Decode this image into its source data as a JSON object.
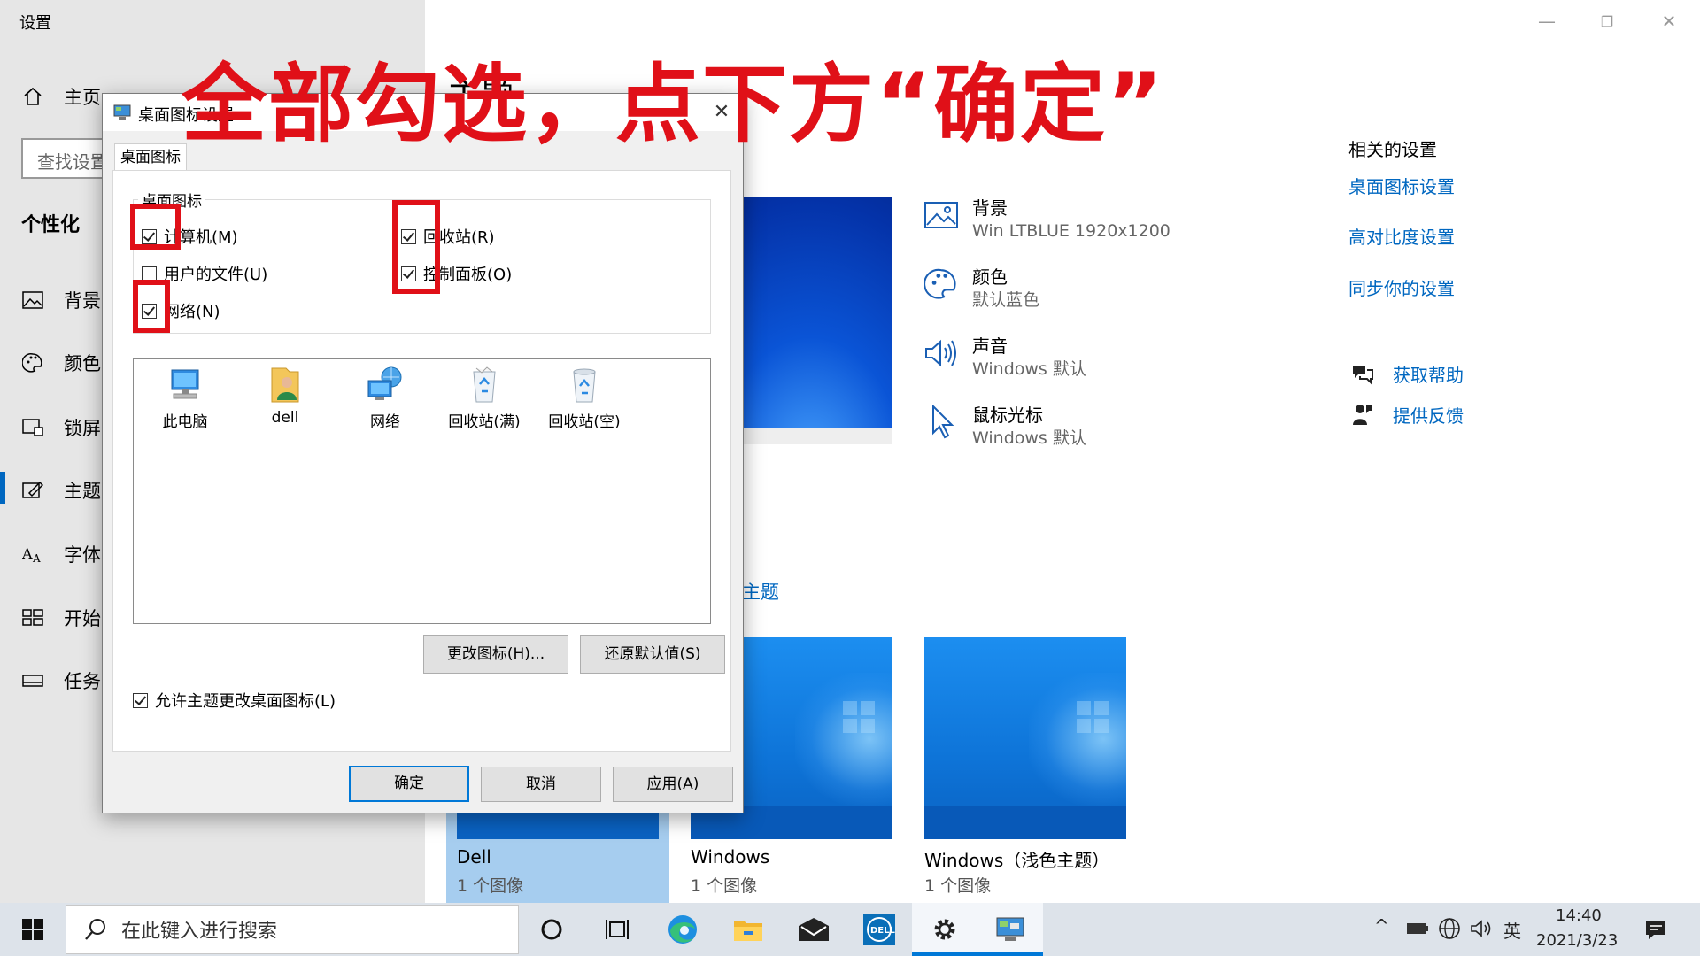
{
  "app": {
    "title": "设置",
    "minimize_glyph": "—",
    "maximize_glyph": "❐",
    "close_glyph": "✕"
  },
  "sidebar": {
    "home_label": "主页",
    "search_placeholder": "查找设置",
    "section_title": "个性化",
    "items": [
      {
        "label": "背景",
        "icon": "picture-icon"
      },
      {
        "label": "颜色",
        "icon": "palette-icon"
      },
      {
        "label": "锁屏",
        "icon": "lockscreen-icon"
      },
      {
        "label": "主题",
        "icon": "theme-icon",
        "active": true
      },
      {
        "label": "字体",
        "icon": "font-icon"
      },
      {
        "label": "开始",
        "icon": "start-icon"
      },
      {
        "label": "任务",
        "icon": "taskbar-icon"
      }
    ]
  },
  "main": {
    "page_title": "主题",
    "properties": [
      {
        "title": "背景",
        "value": "Win LTBLUE 1920x1200",
        "icon": "picture-icon"
      },
      {
        "title": "颜色",
        "value": "默认蓝色",
        "icon": "palette-icon"
      },
      {
        "title": "声音",
        "value": "Windows 默认",
        "icon": "speaker-icon"
      },
      {
        "title": "鼠标光标",
        "value": "Windows 默认",
        "icon": "cursor-icon"
      }
    ],
    "more_themes_link": "主题",
    "themes": [
      {
        "name": "Dell",
        "count": "1 个图像",
        "selected": true
      },
      {
        "name": "Windows",
        "count": "1 个图像"
      },
      {
        "name": "Windows（浅色主题）",
        "count": "1 个图像"
      }
    ]
  },
  "related": {
    "title": "相关的设置",
    "links": [
      "桌面图标设置",
      "高对比度设置",
      "同步你的设置"
    ],
    "help_label": "获取帮助",
    "feedback_label": "提供反馈"
  },
  "dialog": {
    "title": "桌面图标设置",
    "close_glyph": "✕",
    "tab_label": "桌面图标",
    "group_label": "桌面图标",
    "checkboxes": [
      {
        "label": "计算机(M)",
        "checked": true
      },
      {
        "label": "回收站(R)",
        "checked": true
      },
      {
        "label": "用户的文件(U)",
        "checked": false
      },
      {
        "label": "控制面板(O)",
        "checked": true
      },
      {
        "label": "网络(N)",
        "checked": true
      }
    ],
    "icons": [
      {
        "label": "此电脑",
        "icon": "computer-icon"
      },
      {
        "label": "dell",
        "icon": "user-folder-icon"
      },
      {
        "label": "网络",
        "icon": "network-icon"
      },
      {
        "label": "回收站(满)",
        "icon": "recycle-bin-full-icon"
      },
      {
        "label": "回收站(空)",
        "icon": "recycle-bin-empty-icon"
      }
    ],
    "change_icon_button": "更改图标(H)...",
    "restore_default_button": "还原默认值(S)",
    "allow_themes_label": "允许主题更改桌面图标(L)",
    "allow_themes_checked": true,
    "ok_button": "确定",
    "cancel_button": "取消",
    "apply_button": "应用(A)"
  },
  "annotation": {
    "text": "全部勾选，点下方“确定”",
    "color": "#e01018"
  },
  "taskbar": {
    "search_placeholder": "在此键入进行搜索",
    "apps": [
      "cortana-icon",
      "task-view-icon",
      "edge-icon",
      "file-explorer-icon",
      "mail-icon",
      "dell-icon",
      "settings-icon",
      "desktop-icon-settings-icon"
    ],
    "tray_chevron": "^",
    "ime": "英",
    "time": "14:40",
    "date": "2021/3/23"
  },
  "colors": {
    "accent": "#0067c0",
    "sidebar_bg": "#e6e6e6",
    "taskbar_bg": "#dde3ea",
    "annotation_red": "#e01018"
  }
}
